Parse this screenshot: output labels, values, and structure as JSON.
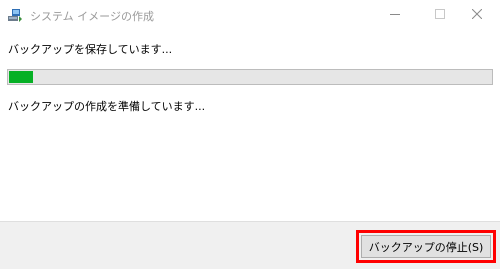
{
  "window": {
    "title": "システム イメージの作成",
    "app_icon": "system-image-backup-icon",
    "controls": [
      "minimize-icon",
      "maximize-icon",
      "close-icon"
    ]
  },
  "status": {
    "text": "バックアップを保存しています..."
  },
  "progress": {
    "fraction": 0.05,
    "color": "#06b025"
  },
  "detail": {
    "text": "バックアップの作成を準備しています..."
  },
  "footer": {
    "stop_button_label": "バックアップの停止(S)"
  },
  "colors": {
    "highlight": "#ff0000"
  }
}
